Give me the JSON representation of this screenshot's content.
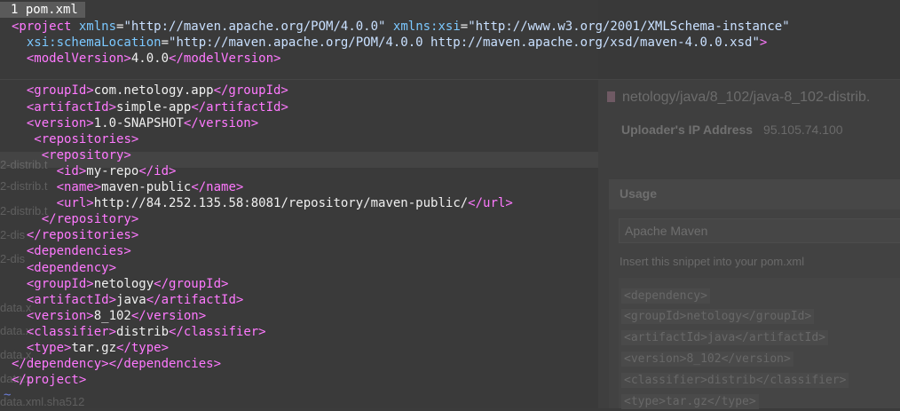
{
  "editor": {
    "tab_label": "1 pom.xml",
    "lines": [
      {
        "parts": [
          [
            "tag",
            "<project "
          ],
          [
            "attr",
            "xmlns"
          ],
          [
            "txt",
            "="
          ],
          [
            "str",
            "\"http://maven.apache.org/POM/4.0.0\""
          ],
          [
            "txt",
            " "
          ],
          [
            "attr",
            "xmlns:xsi"
          ],
          [
            "txt",
            "="
          ],
          [
            "str",
            "\"http://www.w3.org/2001/XMLSchema-instance\""
          ]
        ]
      },
      {
        "parts": [
          [
            "txt",
            "  "
          ],
          [
            "attr",
            "xsi:schemaLocation"
          ],
          [
            "txt",
            "="
          ],
          [
            "str",
            "\"http://maven.apache.org/POM/4.0.0 http://maven.apache.org/xsd/maven-4.0.0.xsd\""
          ],
          [
            "tag",
            ">"
          ]
        ]
      },
      {
        "parts": [
          [
            "txt",
            "  "
          ],
          [
            "tag",
            "<modelVersion>"
          ],
          [
            "txt",
            "4.0.0"
          ],
          [
            "tag",
            "</modelVersion>"
          ]
        ]
      },
      {
        "parts": [
          [
            "txt",
            ""
          ]
        ]
      },
      {
        "parts": [
          [
            "txt",
            "  "
          ],
          [
            "tag",
            "<groupId>"
          ],
          [
            "txt",
            "com.netology.app"
          ],
          [
            "tag",
            "</groupId>"
          ]
        ]
      },
      {
        "parts": [
          [
            "txt",
            "  "
          ],
          [
            "tag",
            "<artifactId>"
          ],
          [
            "txt",
            "simple-app"
          ],
          [
            "tag",
            "</artifactId>"
          ]
        ]
      },
      {
        "parts": [
          [
            "txt",
            "  "
          ],
          [
            "tag",
            "<version>"
          ],
          [
            "txt",
            "1.0-SNAPSHOT"
          ],
          [
            "tag",
            "</version>"
          ]
        ]
      },
      {
        "parts": [
          [
            "txt",
            "   "
          ],
          [
            "tag",
            "<repositories>"
          ]
        ]
      },
      {
        "parts": [
          [
            "txt",
            "    "
          ],
          [
            "tag",
            "<repository>"
          ]
        ]
      },
      {
        "parts": [
          [
            "txt",
            "      "
          ],
          [
            "tag",
            "<id>"
          ],
          [
            "txt",
            "my-repo"
          ],
          [
            "tag",
            "</id>"
          ]
        ]
      },
      {
        "parts": [
          [
            "txt",
            "      "
          ],
          [
            "tag",
            "<name>"
          ],
          [
            "txt",
            "maven-public"
          ],
          [
            "tag",
            "</name>"
          ]
        ]
      },
      {
        "parts": [
          [
            "txt",
            "      "
          ],
          [
            "tag",
            "<url>"
          ],
          [
            "txt",
            "http://84.252.135.58:8081/repository/maven-public/"
          ],
          [
            "tag",
            "</url>"
          ]
        ]
      },
      {
        "parts": [
          [
            "txt",
            "    "
          ],
          [
            "tag",
            "</repository>"
          ]
        ]
      },
      {
        "parts": [
          [
            "txt",
            "  "
          ],
          [
            "tag",
            "</repositories>"
          ]
        ]
      },
      {
        "parts": [
          [
            "txt",
            "  "
          ],
          [
            "tag",
            "<dependencies>"
          ]
        ]
      },
      {
        "parts": [
          [
            "txt",
            "  "
          ],
          [
            "tag",
            "<dependency>"
          ]
        ]
      },
      {
        "parts": [
          [
            "txt",
            "  "
          ],
          [
            "tag",
            "<groupId>"
          ],
          [
            "txt",
            "netology"
          ],
          [
            "tag",
            "</groupId>"
          ]
        ]
      },
      {
        "parts": [
          [
            "txt",
            "  "
          ],
          [
            "tag",
            "<artifactId>"
          ],
          [
            "txt",
            "java"
          ],
          [
            "tag",
            "</artifactId>"
          ]
        ]
      },
      {
        "parts": [
          [
            "txt",
            "  "
          ],
          [
            "tag",
            "<version>"
          ],
          [
            "txt",
            "8_102"
          ],
          [
            "tag",
            "</version>"
          ]
        ]
      },
      {
        "parts": [
          [
            "txt",
            "  "
          ],
          [
            "tag",
            "<classifier>"
          ],
          [
            "txt",
            "distrib"
          ],
          [
            "tag",
            "</classifier>"
          ]
        ]
      },
      {
        "parts": [
          [
            "txt",
            "  "
          ],
          [
            "tag",
            "<type>"
          ],
          [
            "txt",
            "tar.gz"
          ],
          [
            "tag",
            "</type>"
          ]
        ]
      },
      {
        "parts": [
          [
            "tag",
            "</dependency></dependencies>"
          ]
        ]
      },
      {
        "parts": [
          [
            "tag",
            "</project>"
          ]
        ]
      }
    ],
    "tilde": "~",
    "colors": {
      "tag": "#ff79ff",
      "attr": "#7bc8ff",
      "string": "#c9e0ff",
      "text": "#f0f0f0",
      "tilde": "#6c7ed8"
    }
  },
  "background_page": {
    "file_list": [
      "2-distrib.t",
      "2-distrib.t",
      "2-distrib.t",
      "2-dis",
      "2-dis",
      "data.x",
      "data.x",
      "data.x",
      "data.x",
      "data.xml.sha512"
    ],
    "panel": {
      "path": "netology/java/8_102/java-8_102-distrib.",
      "ip_label": "Uploader's IP Address",
      "ip_value": "95.105.74.100",
      "usage_title": "Usage",
      "build_tool": "Apache Maven",
      "snippet_hint": "Insert this snippet into your pom.xml",
      "snippet": [
        "<dependency>",
        "  <groupId>netology</groupId>",
        "  <artifactId>java</artifactId>",
        "  <version>8_102</version>",
        "  <classifier>distrib</classifier>",
        "  <type>tar.gz</type>"
      ]
    }
  }
}
